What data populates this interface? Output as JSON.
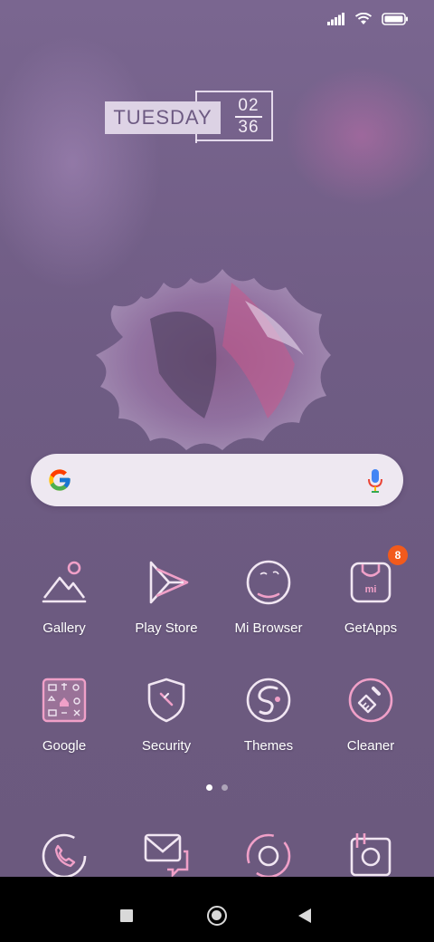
{
  "status_bar": {
    "icons": [
      "signal-icon",
      "wifi-icon",
      "battery-icon"
    ]
  },
  "clock_widget": {
    "day": "TUESDAY",
    "hours": "02",
    "minutes": "36"
  },
  "search": {
    "icons": [
      "google-g-icon",
      "microphone-icon"
    ]
  },
  "apps": [
    {
      "label": "Gallery",
      "icon": "gallery-icon"
    },
    {
      "label": "Play Store",
      "icon": "play-store-icon"
    },
    {
      "label": "Mi Browser",
      "icon": "mi-browser-icon"
    },
    {
      "label": "GetApps",
      "icon": "getapps-icon",
      "badge": "8"
    },
    {
      "label": "Google",
      "icon": "google-folder-icon"
    },
    {
      "label": "Security",
      "icon": "security-shield-icon"
    },
    {
      "label": "Themes",
      "icon": "themes-icon"
    },
    {
      "label": "Cleaner",
      "icon": "cleaner-brush-icon"
    }
  ],
  "pager": {
    "pages": 2,
    "active": 1
  },
  "dock": [
    {
      "icon": "phone-icon"
    },
    {
      "icon": "messages-icon"
    },
    {
      "icon": "camera-icon"
    },
    {
      "icon": "photo-camera-icon"
    }
  ],
  "nav_bar": {
    "icons": [
      "recents-square-icon",
      "home-circle-icon",
      "back-triangle-icon"
    ]
  },
  "colors": {
    "icon_stroke": "#f1e6f2",
    "icon_accent": "#f0a0c8",
    "badge": "#f25a1c",
    "wallpaper": "#6e5b80"
  }
}
